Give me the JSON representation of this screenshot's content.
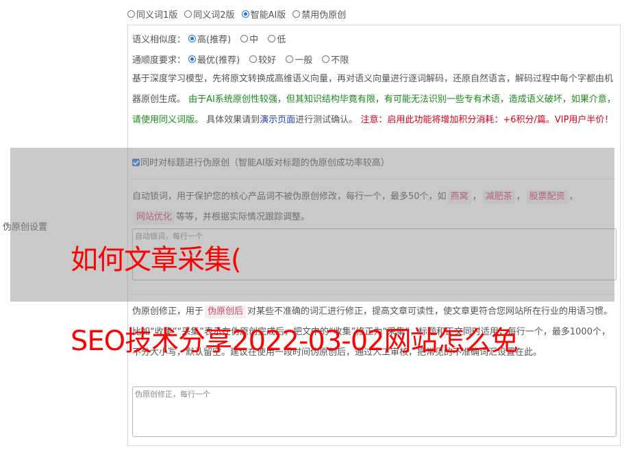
{
  "mode_options": [
    {
      "label": "同义词1版",
      "checked": false
    },
    {
      "label": "同义词2版",
      "checked": false
    },
    {
      "label": "智能AI版",
      "checked": true
    },
    {
      "label": "禁用伪原创",
      "checked": false
    }
  ],
  "similarity": {
    "label": "语义相似度：",
    "options": [
      {
        "label": "高(推荐)",
        "checked": true
      },
      {
        "label": "中",
        "checked": false
      },
      {
        "label": "低",
        "checked": false
      }
    ]
  },
  "fluency": {
    "label": "通顺度要求：",
    "options": [
      {
        "label": "最优(推荐)",
        "checked": true
      },
      {
        "label": "较好",
        "checked": false
      },
      {
        "label": "一般",
        "checked": false
      },
      {
        "label": "不限",
        "checked": false
      }
    ]
  },
  "description": {
    "part1": "基于深度学习模型，先将原文转换成高维语义向量，再对语义向量进行逐词解码，还原自然语言，解码过程中每个字都由机器原创生成。 ",
    "part2_green": "由于AI系统原创性较强，但其知识结构毕竟有限，有可能无法识别一些专有术语，造成语义破坏，如果介意，请使用同义词版。",
    "part3": " 具体效果请到",
    "part4_link": "演示页面",
    "part5": "进行测试确认。 ",
    "part6_red": "注意：启用此功能将增加积分消耗：+6积分/篇。VIP用户半价！"
  },
  "title_checkbox": {
    "label": "同时对标题进行伪原创（智能AI版对标题的伪原创成功率较高）",
    "checked": true
  },
  "lock_words": {
    "text1": "自动锁词，用于保护您的核心产品词不被伪原创修改，每行一个，最多50个，如",
    "examples": [
      "燕窝",
      "减肥茶",
      "股票配资",
      "网站优化"
    ],
    "sep": "，",
    "text2": "等等，并根据实际情况跟踪调整。",
    "placeholder": "自动锁词，每行一个"
  },
  "correction": {
    "text1": "伪原创修正，用于",
    "tag": "伪原创后",
    "text2": "对某些不准确的词汇进行修正，提高文章可读性，使文章更符合您网站所在行业的用语习惯。比如“收集”“采集”表示在伪原创完成后，把文中的“收集”修正为“采集”，标题和正文同时适用，每行一个，最多1000个，不分大小写，默认留空。建议在使用一段时间伪原创后，通过人工审核，把常见的不准确词汇设置在此。",
    "placeholder": "伪原创修正，每行一个"
  },
  "side_label": "伪原创设置",
  "watermark": {
    "line1": "如何文章采集(",
    "line2": "SEO技术分享2022-03-02网站怎么免"
  }
}
